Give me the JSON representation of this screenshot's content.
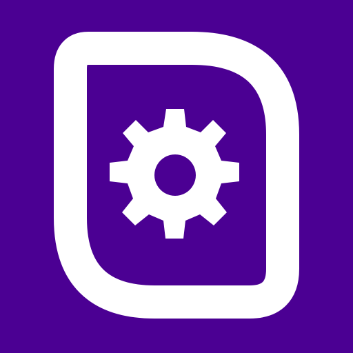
{
  "icon": {
    "name": "app-icon",
    "depicts": "document-with-gear",
    "colors": {
      "background": "#4b0093",
      "foreground": "#ffffff"
    }
  }
}
